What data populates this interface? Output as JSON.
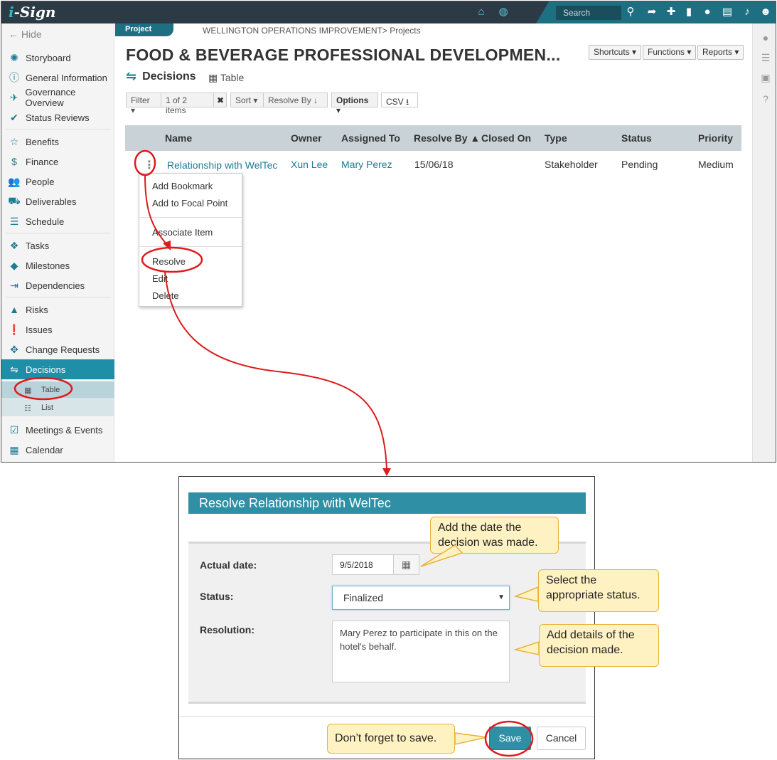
{
  "topbar": {
    "logo_main": "i",
    "logo_rest": "-Sign",
    "search_placeholder": "Search"
  },
  "sidebar": {
    "hide_label": "← Hide",
    "items": [
      {
        "label": "Storyboard"
      },
      {
        "label": "General Information"
      },
      {
        "label": "Governance Overview"
      },
      {
        "label": "Status Reviews"
      },
      {
        "label": "Benefits"
      },
      {
        "label": "Finance"
      },
      {
        "label": "People"
      },
      {
        "label": "Deliverables"
      },
      {
        "label": "Schedule"
      },
      {
        "label": "Tasks"
      },
      {
        "label": "Milestones"
      },
      {
        "label": "Dependencies"
      },
      {
        "label": "Risks"
      },
      {
        "label": "Issues"
      },
      {
        "label": "Change Requests"
      },
      {
        "label": "Decisions"
      },
      {
        "label": "Meetings & Events"
      },
      {
        "label": "Calendar"
      }
    ],
    "sub_items": [
      {
        "label": "Table"
      },
      {
        "label": "List"
      }
    ]
  },
  "header": {
    "project_tab": "Project",
    "breadcrumb": "WELLINGTON OPERATIONS IMPROVEMENT> Projects",
    "title": "FOOD & BEVERAGE PROFESSIONAL DEVELOPMEN...",
    "shortcuts": "Shortcuts ▾",
    "functions": "Functions ▾",
    "reports": "Reports ▾",
    "section": "Decisions",
    "view": "Table"
  },
  "toolbar": {
    "filter": "Filter ▾",
    "count": "1 of 2 items",
    "clear": "✖",
    "sort": "Sort ▾",
    "sort_by": "Resolve By ↓",
    "options": "Options ▾",
    "csv": "CSV ⭳"
  },
  "table": {
    "columns": [
      "Name",
      "Owner",
      "Assigned To",
      "Resolve By ▲",
      "Closed On",
      "Type",
      "Status",
      "Priority"
    ],
    "rows": [
      {
        "name": "Relationship with WelTec",
        "owner": "Xun Lee",
        "assigned": "Mary Perez",
        "resolve_by": "15/06/18",
        "closed_on": "",
        "type": "Stakeholder",
        "status": "Pending",
        "priority": "Medium"
      }
    ]
  },
  "context_menu": [
    "Add Bookmark",
    "Add to Focal Point",
    "Associate Item",
    "Resolve",
    "Edit",
    "Delete"
  ],
  "dialog": {
    "title": "Resolve Relationship with WelTec",
    "actual_date_label": "Actual date:",
    "actual_date_value": "9/5/2018",
    "status_label": "Status:",
    "status_value": "Finalized",
    "resolution_label": "Resolution:",
    "resolution_value": "Mary Perez to participate in this on the hotel's behalf.",
    "save": "Save",
    "cancel": "Cancel"
  },
  "callouts": {
    "date": "Add the date the decision was made.",
    "status": "Select the appropriate status.",
    "details": "Add details of the decision made.",
    "save": "Don’t forget to save."
  },
  "colors": {
    "accent": "#1f8ea7",
    "topbar": "#2b3a44",
    "highlight": "#e0191b",
    "callout": "#fff2c2"
  }
}
